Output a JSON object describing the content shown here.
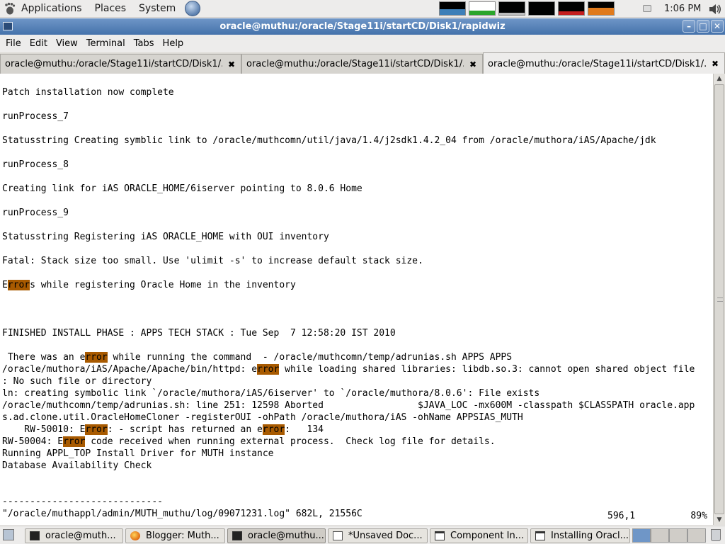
{
  "top_panel": {
    "menus": [
      "Applications",
      "Places",
      "System"
    ],
    "clock": "1:06 PM"
  },
  "window": {
    "title": "oracle@muthu:/oracle/Stage11i/startCD/Disk1/rapidwiz",
    "buttons": [
      "minimize",
      "maximize",
      "close"
    ]
  },
  "menu_bar": [
    "File",
    "Edit",
    "View",
    "Terminal",
    "Tabs",
    "Help"
  ],
  "tabs": [
    {
      "label": "oracle@muthu:/oracle/Stage11i/startCD/Disk1/...",
      "active": false
    },
    {
      "label": "oracle@muthu:/oracle/Stage11i/startCD/Disk1/...",
      "active": false
    },
    {
      "label": "oracle@muthu:/oracle/Stage11i/startCD/Disk1/...",
      "active": true
    }
  ],
  "terminal": {
    "lines": [
      "",
      "Patch installation now complete",
      "",
      "runProcess_7",
      "",
      "Statusstring Creating symblic link to /oracle/muthcomn/util/java/1.4/j2sdk1.4.2_04 from /oracle/muthora/iAS/Apache/jdk",
      "",
      "runProcess_8",
      "",
      "Creating link for iAS ORACLE_HOME/6iserver pointing to 8.0.6 Home",
      "",
      "runProcess_9",
      "",
      "Statusstring Registering iAS ORACLE_HOME with OUI inventory",
      "",
      "Fatal: Stack size too small. Use 'ulimit -s' to increase default stack size.",
      "",
      "Errors while registering Oracle Home in the inventory",
      "",
      "",
      "",
      "FINISHED INSTALL PHASE : APPS TECH STACK : Tue Sep  7 12:58:20 IST 2010",
      "",
      " There was an error while running the command  - /oracle/muthcomn/temp/adrunias.sh APPS APPS",
      "/oracle/muthora/iAS/Apache/Apache/bin/httpd: error while loading shared libraries: libdb.so.3: cannot open shared object file",
      ": No such file or directory",
      "ln: creating symbolic link `/oracle/muthora/iAS/6iserver' to `/oracle/muthora/8.0.6': File exists",
      "/oracle/muthcomn/temp/adrunias.sh: line 251: 12598 Aborted                 $JAVA_LOC -mx600M -classpath $CLASSPATH oracle.app",
      "s.ad.clone.util.OracleHomeCloner -registerOUI -ohPath /oracle/muthora/iAS -ohName APPSIAS_MUTH",
      "    RW-50010: Error: - script has returned an error:   134",
      "RW-50004: Error code received when running external process.  Check log file for details.",
      "Running APPL_TOP Install Driver for MUTH instance",
      "Database Availability Check",
      "",
      "",
      "-----------------------------",
      "\"/oracle/muthappl/admin/MUTH_muthu/log/09071231.log\" 682L, 21556C"
    ],
    "status_position": "596,1",
    "status_percent": "89%"
  },
  "taskbar": {
    "tasks": [
      {
        "label": "oracle@muth...",
        "icon": "terminal-icon",
        "active": false
      },
      {
        "label": "Blogger: Muth...",
        "icon": "firefox-icon",
        "active": false
      },
      {
        "label": "oracle@muthu...",
        "icon": "terminal-icon",
        "active": true
      },
      {
        "label": "*Unsaved Doc...",
        "icon": "text-editor-icon",
        "active": false
      },
      {
        "label": "Component In...",
        "icon": "window-icon",
        "active": false
      },
      {
        "label": "Installing Oracl...",
        "icon": "window-icon",
        "active": false
      }
    ],
    "workspaces": 4,
    "active_workspace": 1
  },
  "highlights": {
    "color": "#a85a00",
    "term": "rror"
  }
}
